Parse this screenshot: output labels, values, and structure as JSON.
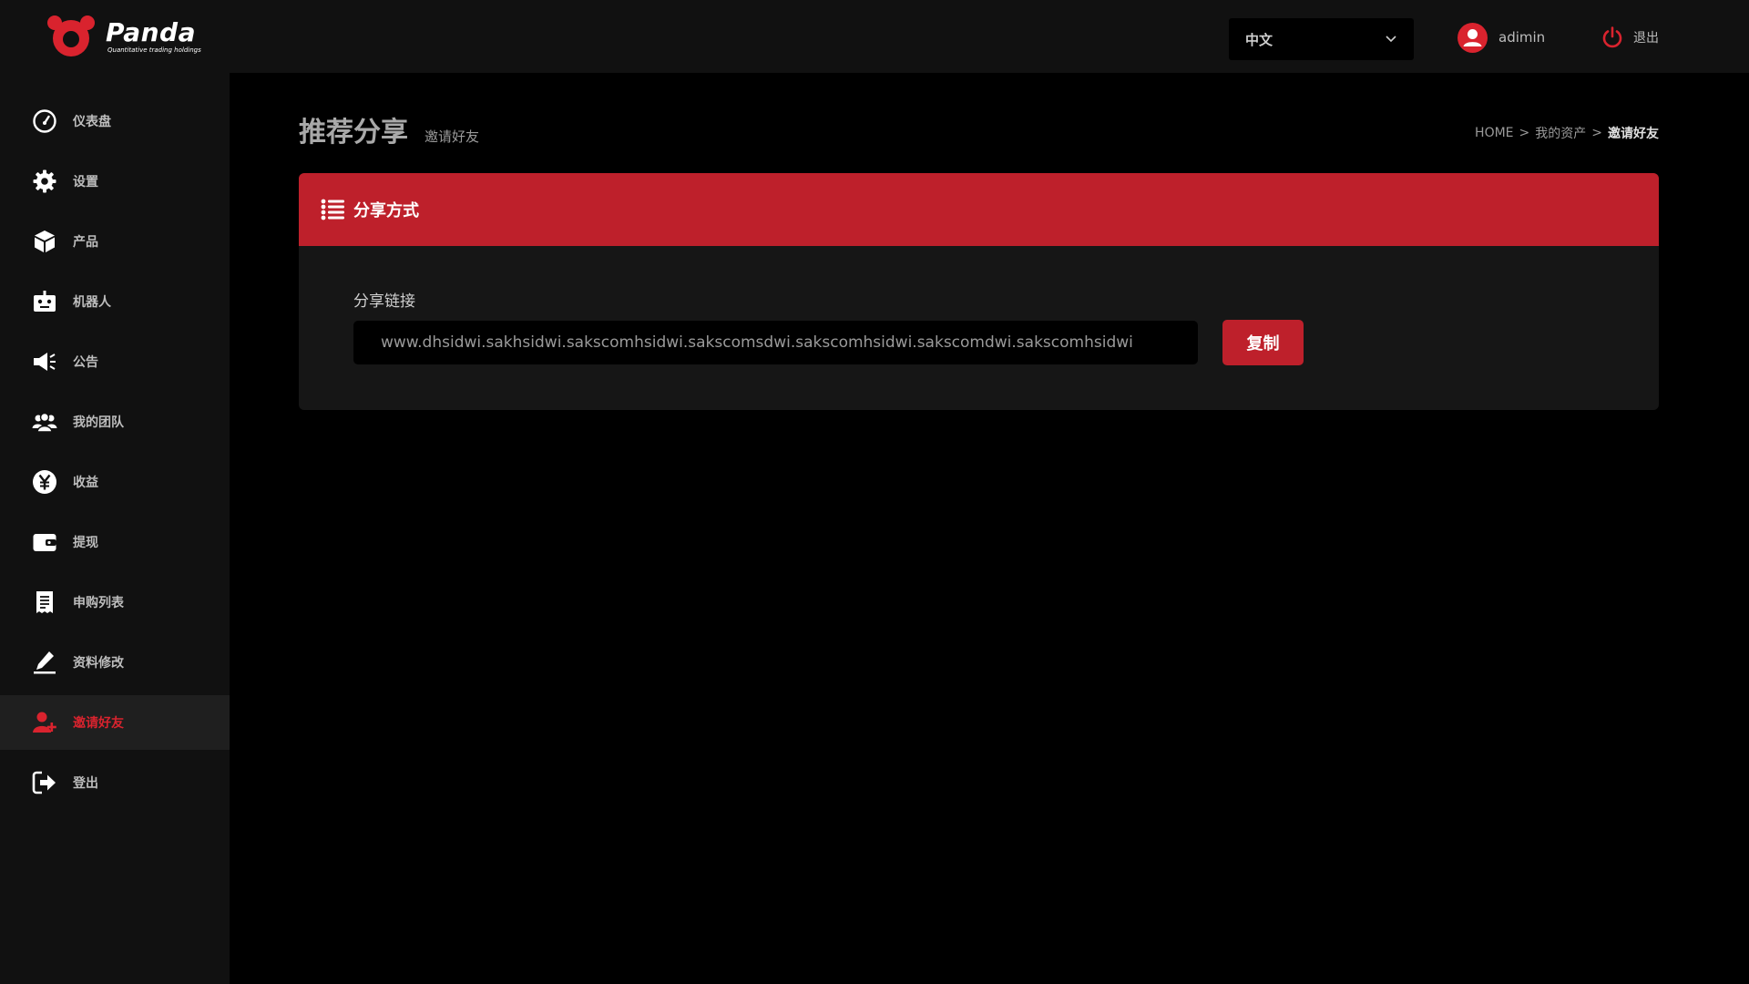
{
  "brand": {
    "name": "Panda",
    "tagline": "Quantitative trading holdings",
    "accent_color": "#be202b"
  },
  "header": {
    "language": {
      "selected": "中文"
    },
    "user": {
      "name": "adimin",
      "icon": "user-icon"
    },
    "logout": {
      "label": "退出",
      "icon": "power-icon"
    }
  },
  "sidebar": {
    "items": [
      {
        "label": "仪表盘",
        "icon": "dashboard-icon"
      },
      {
        "label": "设置",
        "icon": "gear-icon"
      },
      {
        "label": "产品",
        "icon": "box-icon"
      },
      {
        "label": "机器人",
        "icon": "robot-icon"
      },
      {
        "label": "公告",
        "icon": "megaphone-icon"
      },
      {
        "label": "我的团队",
        "icon": "team-icon"
      },
      {
        "label": "收益",
        "icon": "yen-icon"
      },
      {
        "label": "提现",
        "icon": "wallet-icon"
      },
      {
        "label": "申购列表",
        "icon": "receipt-icon"
      },
      {
        "label": "资料修改",
        "icon": "edit-icon"
      },
      {
        "label": "邀请好友",
        "icon": "add-user-icon",
        "active": true
      },
      {
        "label": "登出",
        "icon": "sign-out-icon"
      }
    ]
  },
  "page": {
    "title": "推荐分享",
    "subtitle": "邀请好友",
    "breadcrumb": [
      "HOME",
      "我的资产",
      "邀请好友"
    ]
  },
  "card": {
    "title": "分享方式",
    "field_label": "分享链接",
    "link_value": "www.dhsidwi.sakhsidwi.sakscomhsidwi.sakscomsdwi.sakscomhsidwi.sakscomdwi.sakscomhsidwi",
    "copy_label": "复制"
  }
}
